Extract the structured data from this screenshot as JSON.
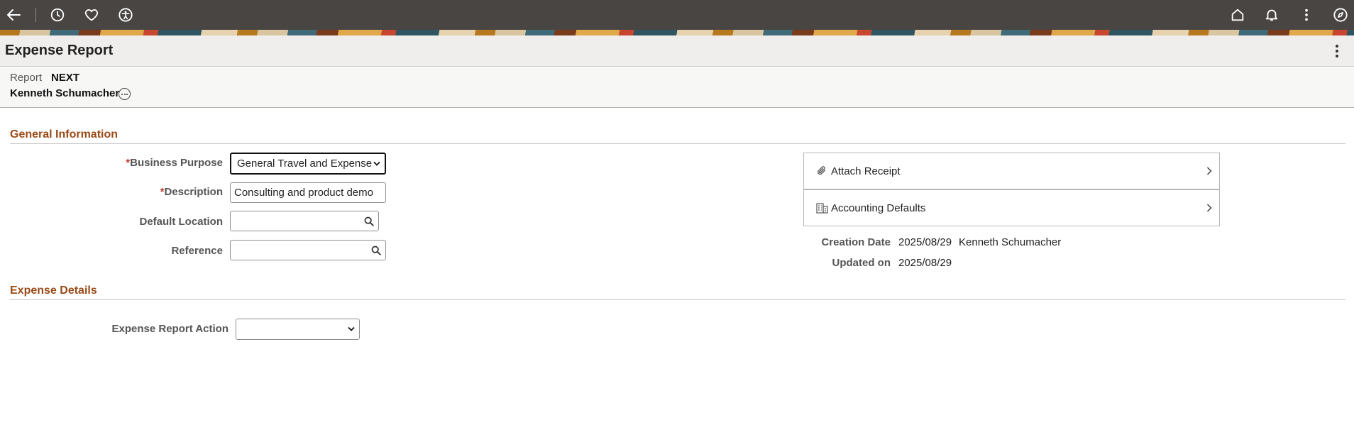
{
  "topbar": {
    "back_icon": "arrow-left-icon",
    "recent_icon": "clock-icon",
    "favorites_icon": "heart-icon",
    "accessibility_icon": "accessibility-icon",
    "home_icon": "home-icon",
    "notifications_icon": "bell-icon",
    "actions_icon": "more-vertical-icon",
    "navigator_icon": "compass-icon",
    "bar_color": "#494543"
  },
  "header": {
    "title": "Expense Report"
  },
  "report": {
    "label": "Report",
    "id": "NEXT",
    "employee": "Kenneth Schumacher"
  },
  "general_information": {
    "section_title": "General Information",
    "business_purpose": {
      "required_mark": "*",
      "label": "Business Purpose",
      "value": "General Travel and Expense"
    },
    "description": {
      "required_mark": "*",
      "label": "Description",
      "value": "Consulting and product demo"
    },
    "default_location": {
      "label": "Default Location",
      "value": ""
    },
    "reference": {
      "label": "Reference",
      "value": ""
    }
  },
  "side_panel": {
    "attach_receipt": "Attach Receipt",
    "accounting_defaults": "Accounting Defaults",
    "creation_date_label": "Creation Date",
    "creation_date": "2025/08/29",
    "created_by": "Kenneth Schumacher",
    "updated_on_label": "Updated on",
    "updated_on": "2025/08/29"
  },
  "expense_details": {
    "section_title": "Expense Details",
    "action_label": "Expense Report Action",
    "action_value": ""
  },
  "colors": {
    "section_title": "#9a4a16",
    "required": "#c0392b"
  }
}
